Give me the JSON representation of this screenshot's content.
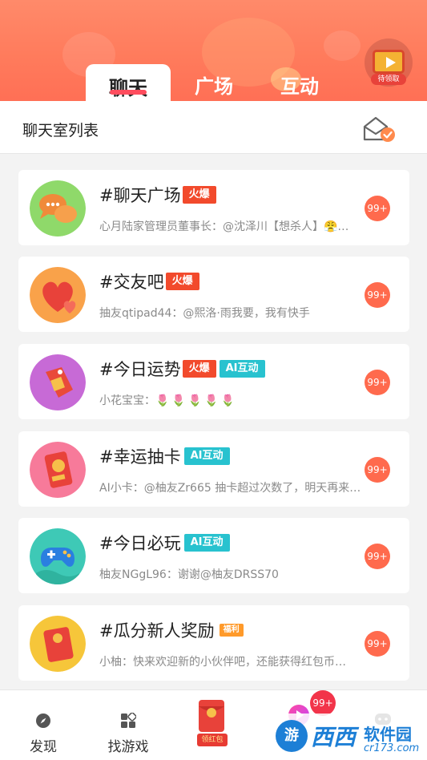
{
  "header": {
    "tabs": [
      {
        "label": "聊天",
        "active": true
      },
      {
        "label": "广场",
        "active": false
      },
      {
        "label": "互动",
        "active": false
      }
    ],
    "gift_label": "待领取"
  },
  "section": {
    "title": "聊天室列表"
  },
  "rooms": [
    {
      "title": "#聊天广场",
      "tags": [
        "火爆"
      ],
      "sub": "心月陆家管理员董事长：@沈泽川【想杀人】😤…",
      "badge": "99+"
    },
    {
      "title": "#交友吧",
      "tags": [
        "火爆"
      ],
      "sub": "抽友qtipad44：@熙洛·雨我要，我有快手",
      "badge": "99+"
    },
    {
      "title": "#今日运势",
      "tags": [
        "火爆",
        "AI互动"
      ],
      "sub": "小花宝宝：",
      "sub_emoji": "🌷🌷🌷🌷🌷",
      "badge": "99+"
    },
    {
      "title": "#幸运抽卡",
      "tags": [
        "AI互动"
      ],
      "sub": "AI小卡：@柚友Zr665 抽卡超过次数了，明天再来…",
      "badge": "99+"
    },
    {
      "title": "#今日必玩",
      "tags": [
        "AI互动"
      ],
      "sub": "柚友NGgL96：谢谢@柚友DRSS70",
      "badge": "99+"
    },
    {
      "title": "#瓜分新人奖励",
      "tags": [
        "福利"
      ],
      "sub": "小柚：快来欢迎新的小伙伴吧，还能获得红包币…",
      "badge": "99+"
    }
  ],
  "bottom_nav": {
    "items": [
      {
        "label": "发现",
        "icon": "compass-icon"
      },
      {
        "label": "找游戏",
        "icon": "grid-icon"
      }
    ],
    "hongbao_label": "领红包",
    "badge": "99+"
  },
  "watermark": {
    "brand": "西西",
    "name": "软件园",
    "url": "cr173.com",
    "circle": "游"
  },
  "colors": {
    "header": "#ff7b5c",
    "hot_tag": "#f24a2c",
    "ai_tag": "#28c2cf",
    "badge": "#ff6a4d"
  }
}
